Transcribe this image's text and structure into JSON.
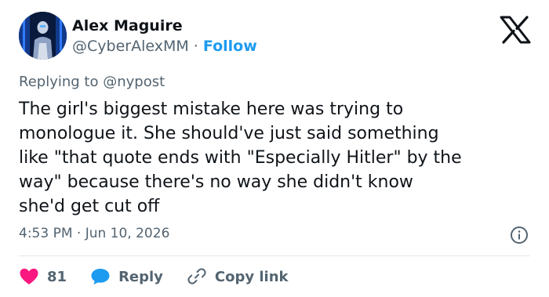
{
  "author": {
    "name": "Alex Maguire",
    "handle": "@CyberAlexMM",
    "separator": "·",
    "follow_label": "Follow"
  },
  "reply": {
    "prefix": "Replying to",
    "mention": "@nypost"
  },
  "tweet": {
    "text": "The girl's biggest mistake here was trying to\nmonologue it. She should've just said something\nlike \"that quote ends with \"Especially Hitler\" by the\nway\" because there's no way she didn't know\nshe'd get cut off",
    "timestamp": "4:53 PM · Jun 10, 2026"
  },
  "actions": {
    "like_count": "81",
    "reply_label": "Reply",
    "copy_link_label": "Copy link"
  },
  "colors": {
    "accent": "#1d9bf0",
    "like": "#f91880",
    "muted": "#536471",
    "text": "#0f1419"
  },
  "icons": {
    "brand": "x-logo-icon",
    "info": "info-icon",
    "like": "heart-icon",
    "reply": "speech-bubble-icon",
    "copy_link": "link-icon"
  }
}
